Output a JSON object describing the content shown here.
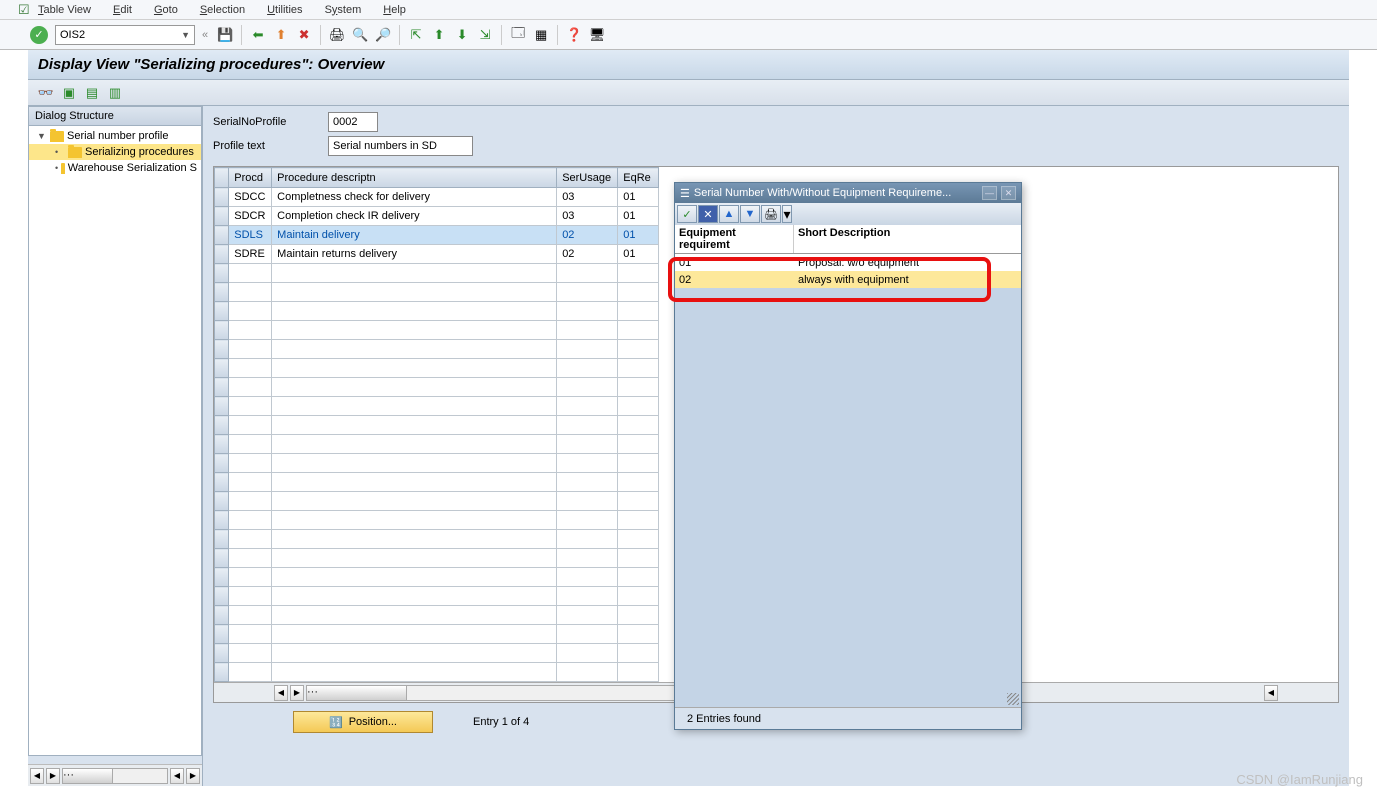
{
  "menu": {
    "items": [
      "Table View",
      "Edit",
      "Goto",
      "Selection",
      "Utilities",
      "System",
      "Help"
    ]
  },
  "toolbar": {
    "tcode": "OIS2"
  },
  "title": "Display View \"Serializing procedures\": Overview",
  "sidebar": {
    "header": "Dialog Structure",
    "items": [
      {
        "label": "Serial number profile",
        "level": 1,
        "open": true,
        "selected": false,
        "hasChildren": true
      },
      {
        "label": "Serializing procedures",
        "level": 2,
        "open": true,
        "selected": true,
        "hasChildren": false
      },
      {
        "label": "Warehouse Serialization S",
        "level": 2,
        "open": false,
        "selected": false,
        "hasChildren": false
      }
    ]
  },
  "form": {
    "profile_label": "SerialNoProfile",
    "profile_value": "0002",
    "text_label": "Profile text",
    "text_value": "Serial numbers in SD"
  },
  "table": {
    "headers": [
      "Procd",
      "Procedure descriptn",
      "SerUsage",
      "EqRe"
    ],
    "rows": [
      {
        "procd": "SDCC",
        "desc": "Completness check for delivery",
        "ser": "03",
        "eq": "01",
        "sel": false
      },
      {
        "procd": "SDCR",
        "desc": "Completion check IR delivery",
        "ser": "03",
        "eq": "01",
        "sel": false
      },
      {
        "procd": "SDLS",
        "desc": "Maintain delivery",
        "ser": "02",
        "eq": "01",
        "sel": true
      },
      {
        "procd": "SDRE",
        "desc": "Maintain returns delivery",
        "ser": "02",
        "eq": "01",
        "sel": false
      }
    ],
    "empty_rows": 22
  },
  "footer": {
    "position_label": "Position...",
    "entry_text": "Entry 1 of 4"
  },
  "popup": {
    "title": "Serial Number With/Without Equipment Requireme...",
    "headers": [
      "Equipment requiremt",
      "Short Description"
    ],
    "rows": [
      {
        "code": "01",
        "desc": "Proposal: w/o equipment",
        "highlight": false
      },
      {
        "code": "02",
        "desc": "always with equipment",
        "highlight": true
      }
    ],
    "footer": "2 Entries found"
  },
  "watermark": "CSDN @IamRunjiang"
}
